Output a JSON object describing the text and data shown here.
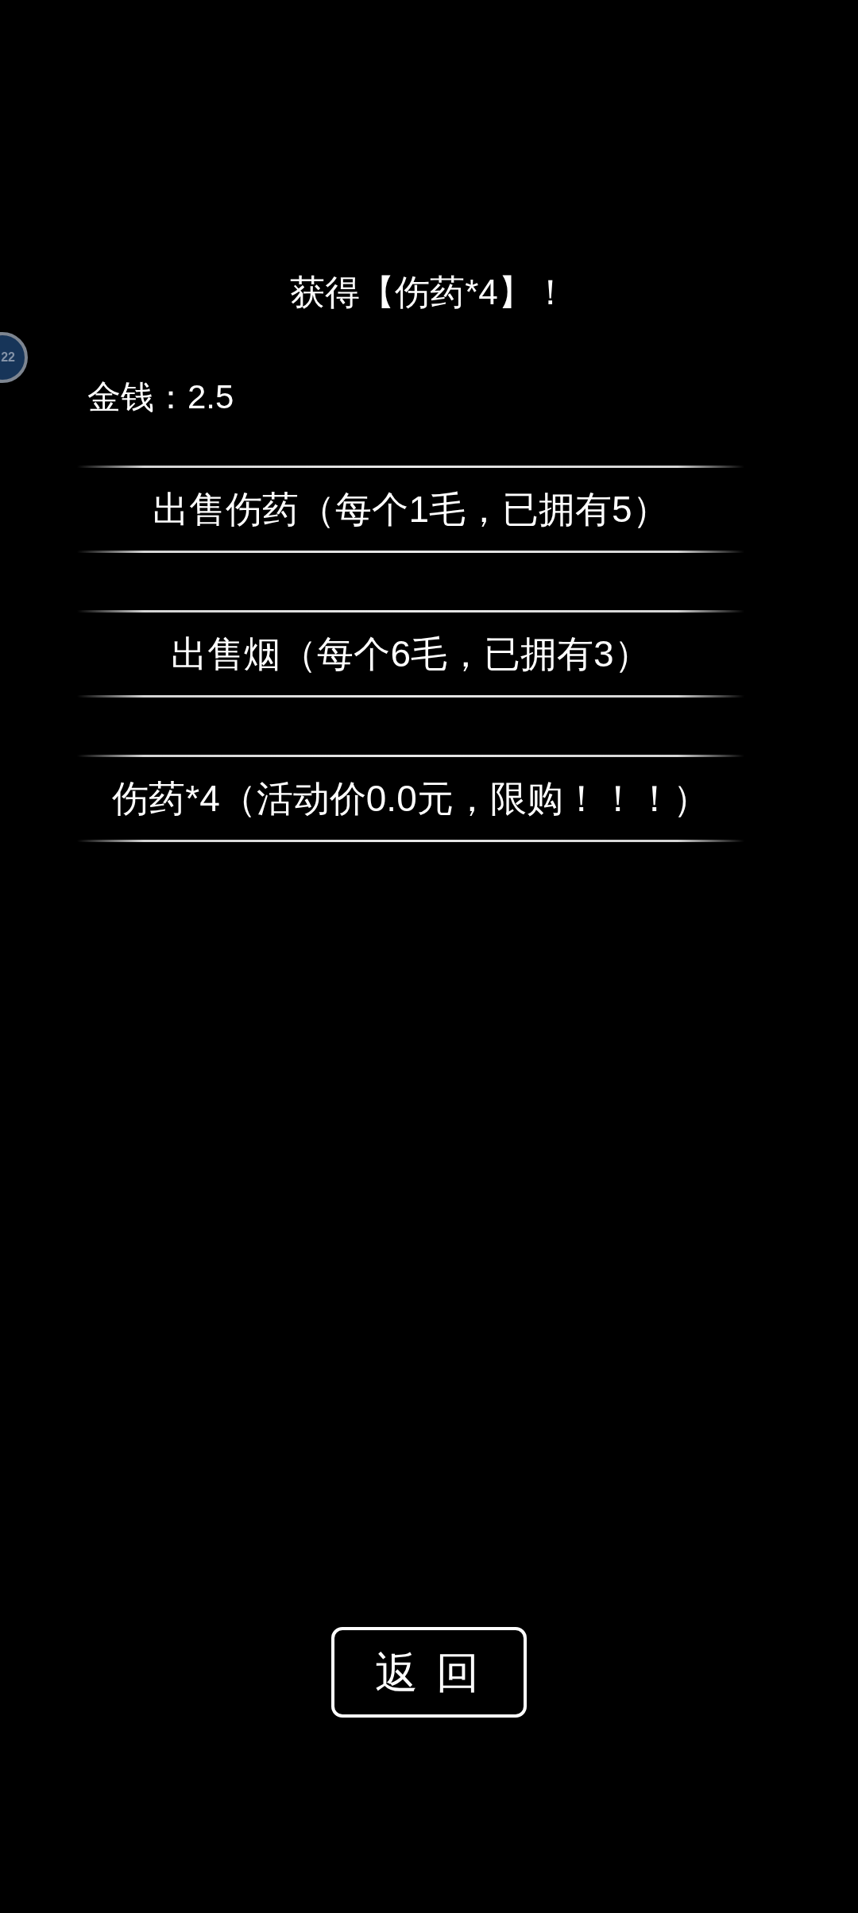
{
  "floating_ball": {
    "label": "22"
  },
  "message": "获得【伤药*4】！",
  "money": {
    "label": "金钱：2.5"
  },
  "options": [
    {
      "label": "出售伤药（每个1毛，已拥有5）"
    },
    {
      "label": "出售烟（每个6毛，已拥有3）"
    },
    {
      "label": "伤药*4（活动价0.0元，限购！！！）"
    }
  ],
  "back_button": {
    "label": "返 回"
  }
}
